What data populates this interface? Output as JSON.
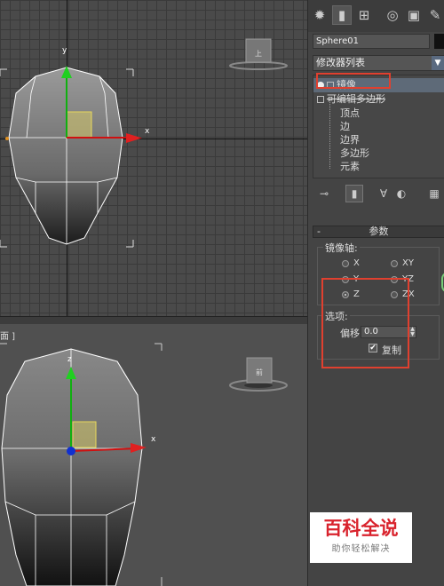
{
  "viewport_top": {
    "axis_x_label": "x"
  },
  "viewport_bottom": {
    "label": "面 ]",
    "axis_x_label": "x"
  },
  "panel": {
    "tabs": [
      {
        "icon": "sun-icon",
        "glyph": "✹"
      },
      {
        "icon": "modify-icon",
        "glyph": "▮"
      },
      {
        "icon": "hierarchy-icon",
        "glyph": "⊞"
      },
      {
        "icon": "motion-icon",
        "glyph": "◎"
      },
      {
        "icon": "display-icon",
        "glyph": "▣"
      },
      {
        "icon": "utilities-icon",
        "glyph": "✎"
      }
    ],
    "object_name": "Sphere01",
    "modifier_list": "修改器列表",
    "stack": [
      {
        "label": "镜像",
        "type": "modifier",
        "selected": true
      },
      {
        "label": "可编辑多边形",
        "type": "base",
        "selected": false
      },
      {
        "label": "顶点",
        "type": "sub"
      },
      {
        "label": "边",
        "type": "sub"
      },
      {
        "label": "边界",
        "type": "sub"
      },
      {
        "label": "多边形",
        "type": "sub"
      },
      {
        "label": "元素",
        "type": "sub"
      }
    ],
    "rollout_title": "参数",
    "mirror_axis": {
      "title": "镜像轴:",
      "options": [
        "X",
        "XY",
        "Y",
        "YZ",
        "Z",
        "ZX"
      ],
      "selected": "Z"
    },
    "options_group": {
      "title": "选项:",
      "offset_label": "偏移:",
      "offset_value": "0.0",
      "copy_label": "复制",
      "copy_checked": true
    }
  },
  "watermark": {
    "title": "百科全说",
    "subtitle": "助你轻松解决"
  },
  "colors": {
    "highlight": "#e0402f",
    "x_axis": "#d01010",
    "y_axis": "#10b010",
    "z_axis": "#1030d0"
  }
}
